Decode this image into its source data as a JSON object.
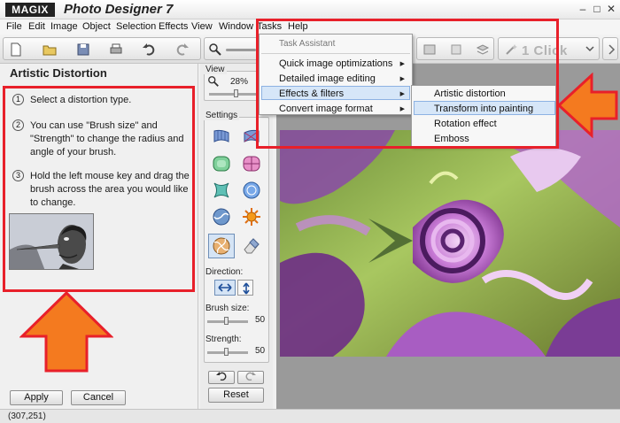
{
  "app": {
    "logo": "MAGIX",
    "title": "Photo Designer 7"
  },
  "window_controls": {
    "minimize": "–",
    "maximize": "□",
    "close": "✕"
  },
  "menu": [
    "File",
    "Edit",
    "Image",
    "Object",
    "Selection",
    "Effects",
    "View",
    "Window",
    "Tasks",
    "Help"
  ],
  "toolbar": {
    "one_click": "1 Click"
  },
  "panel": {
    "title": "Artistic Distortion",
    "steps": [
      {
        "num": "1",
        "text": "Select a distortion type."
      },
      {
        "num": "2",
        "text": "You can use \"Brush size\" and \"Strength\" to change the radius and angle of your brush."
      },
      {
        "num": "3",
        "text": "Hold the left mouse key and drag the brush across the area you would like to change."
      }
    ],
    "apply_label": "Apply",
    "cancel_label": "Cancel"
  },
  "tools": {
    "view_label": "View",
    "zoom": "28%",
    "settings_label": "Settings",
    "direction_label": "Direction:",
    "brush_size_label": "Brush size:",
    "brush_size_value": "50",
    "strength_label": "Strength:",
    "strength_value": "50",
    "reset_label": "Reset"
  },
  "tasks_menu": {
    "header": "Task Assistant",
    "items": [
      "Quick image optimizations",
      "Detailed image editing",
      "Effects & filters",
      "Convert image format"
    ],
    "highlighted": "Effects & filters"
  },
  "submenu": {
    "items": [
      "Artistic distortion",
      "Transform into painting",
      "Rotation effect",
      "Emboss"
    ],
    "highlighted": "Transform into painting"
  },
  "status": {
    "coords": "(307,251)"
  },
  "colors": {
    "annotation_red": "#e8202a",
    "arrow_orange": "#f47a1f",
    "highlight_blue": "#d6e6f8"
  }
}
